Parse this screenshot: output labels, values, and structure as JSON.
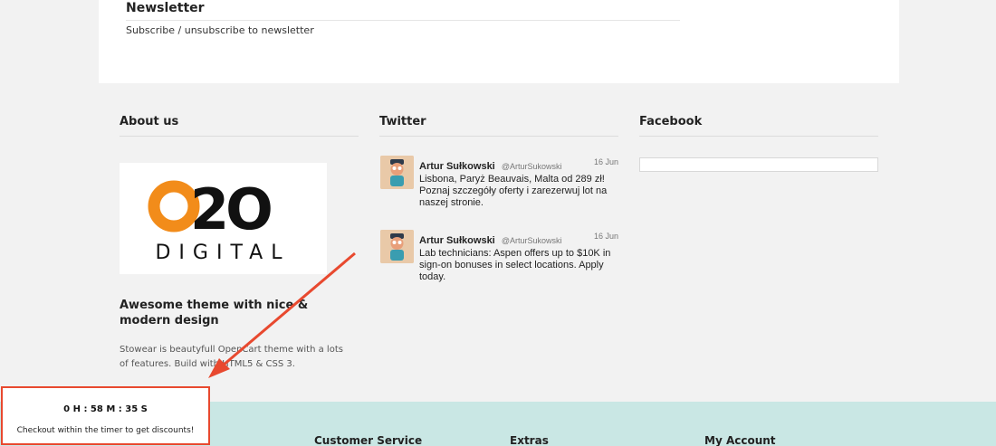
{
  "newsletter": {
    "title": "Newsletter",
    "link": "Subscribe / unsubscribe to newsletter"
  },
  "about": {
    "title": "About us",
    "logo_text": "O2O",
    "logo_subtext": "DIGITAL",
    "heading": "Awesome theme with nice & modern design",
    "text": "Stowear is beautyfull OpenCart theme with a lots of features. Build with HTML5 & CSS 3."
  },
  "twitter": {
    "title": "Twitter",
    "tweets": [
      {
        "name": "Artur Sułkowski",
        "handle": "@ArturSukowski",
        "date": "16 Jun",
        "text": "Lisbona, Paryż Beauvais, Malta od 289 zł! Poznaj szczegóły oferty i zarezerwuj lot na naszej stronie."
      },
      {
        "name": "Artur Sułkowski",
        "handle": "@ArturSukowski",
        "date": "16 Jun",
        "text": "Lab technicians: Aspen offers up to $10K in sign-on bonuses in select locations. Apply today."
      }
    ]
  },
  "facebook": {
    "title": "Facebook"
  },
  "bottom_band": {
    "customer_service": "Customer Service",
    "extras": "Extras",
    "my_account": "My Account"
  },
  "timer": {
    "value": "0 H : 58 M : 35 S",
    "message": "Checkout within the timer to get discounts!"
  },
  "colors": {
    "accent_red": "#e8492f",
    "logo_orange": "#f28c1a",
    "teal_band": "#c9e7e4"
  },
  "icons": {
    "avatar": "cartoon-police-avatar-icon",
    "arrow": "annotation-arrow"
  }
}
